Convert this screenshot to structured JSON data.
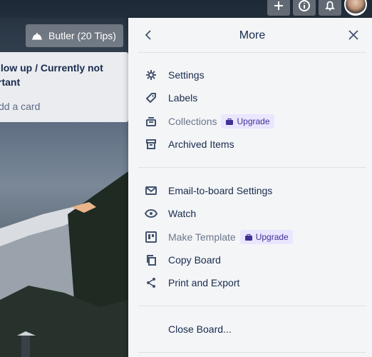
{
  "board": {
    "butler_label": "Butler (20 Tips)",
    "list_title": "llow up / Currently not\nrtant",
    "add_card": "dd a card"
  },
  "panel": {
    "title": "More",
    "groups": [
      [
        {
          "label": "Settings",
          "icon": "gear-icon",
          "muted": false
        },
        {
          "label": "Labels",
          "icon": "label-icon",
          "muted": false
        },
        {
          "label": "Collections",
          "icon": "collection-icon",
          "muted": true,
          "badge": "Upgrade"
        },
        {
          "label": "Archived Items",
          "icon": "archive-icon",
          "muted": false
        }
      ],
      [
        {
          "label": "Email-to-board Settings",
          "icon": "email-icon",
          "muted": false
        },
        {
          "label": "Watch",
          "icon": "eye-icon",
          "muted": false
        },
        {
          "label": "Make Template",
          "icon": "template-icon",
          "muted": true,
          "badge": "Upgrade"
        },
        {
          "label": "Copy Board",
          "icon": "copy-icon",
          "muted": false
        },
        {
          "label": "Print and Export",
          "icon": "share-icon",
          "muted": false
        }
      ],
      [
        {
          "label": "Close Board...",
          "icon": "",
          "muted": false
        }
      ]
    ]
  },
  "colors": {
    "panel_bg": "#f4f5f7",
    "text": "#172b4d",
    "upgrade_bg": "#eae6ff",
    "upgrade_text": "#403294"
  }
}
